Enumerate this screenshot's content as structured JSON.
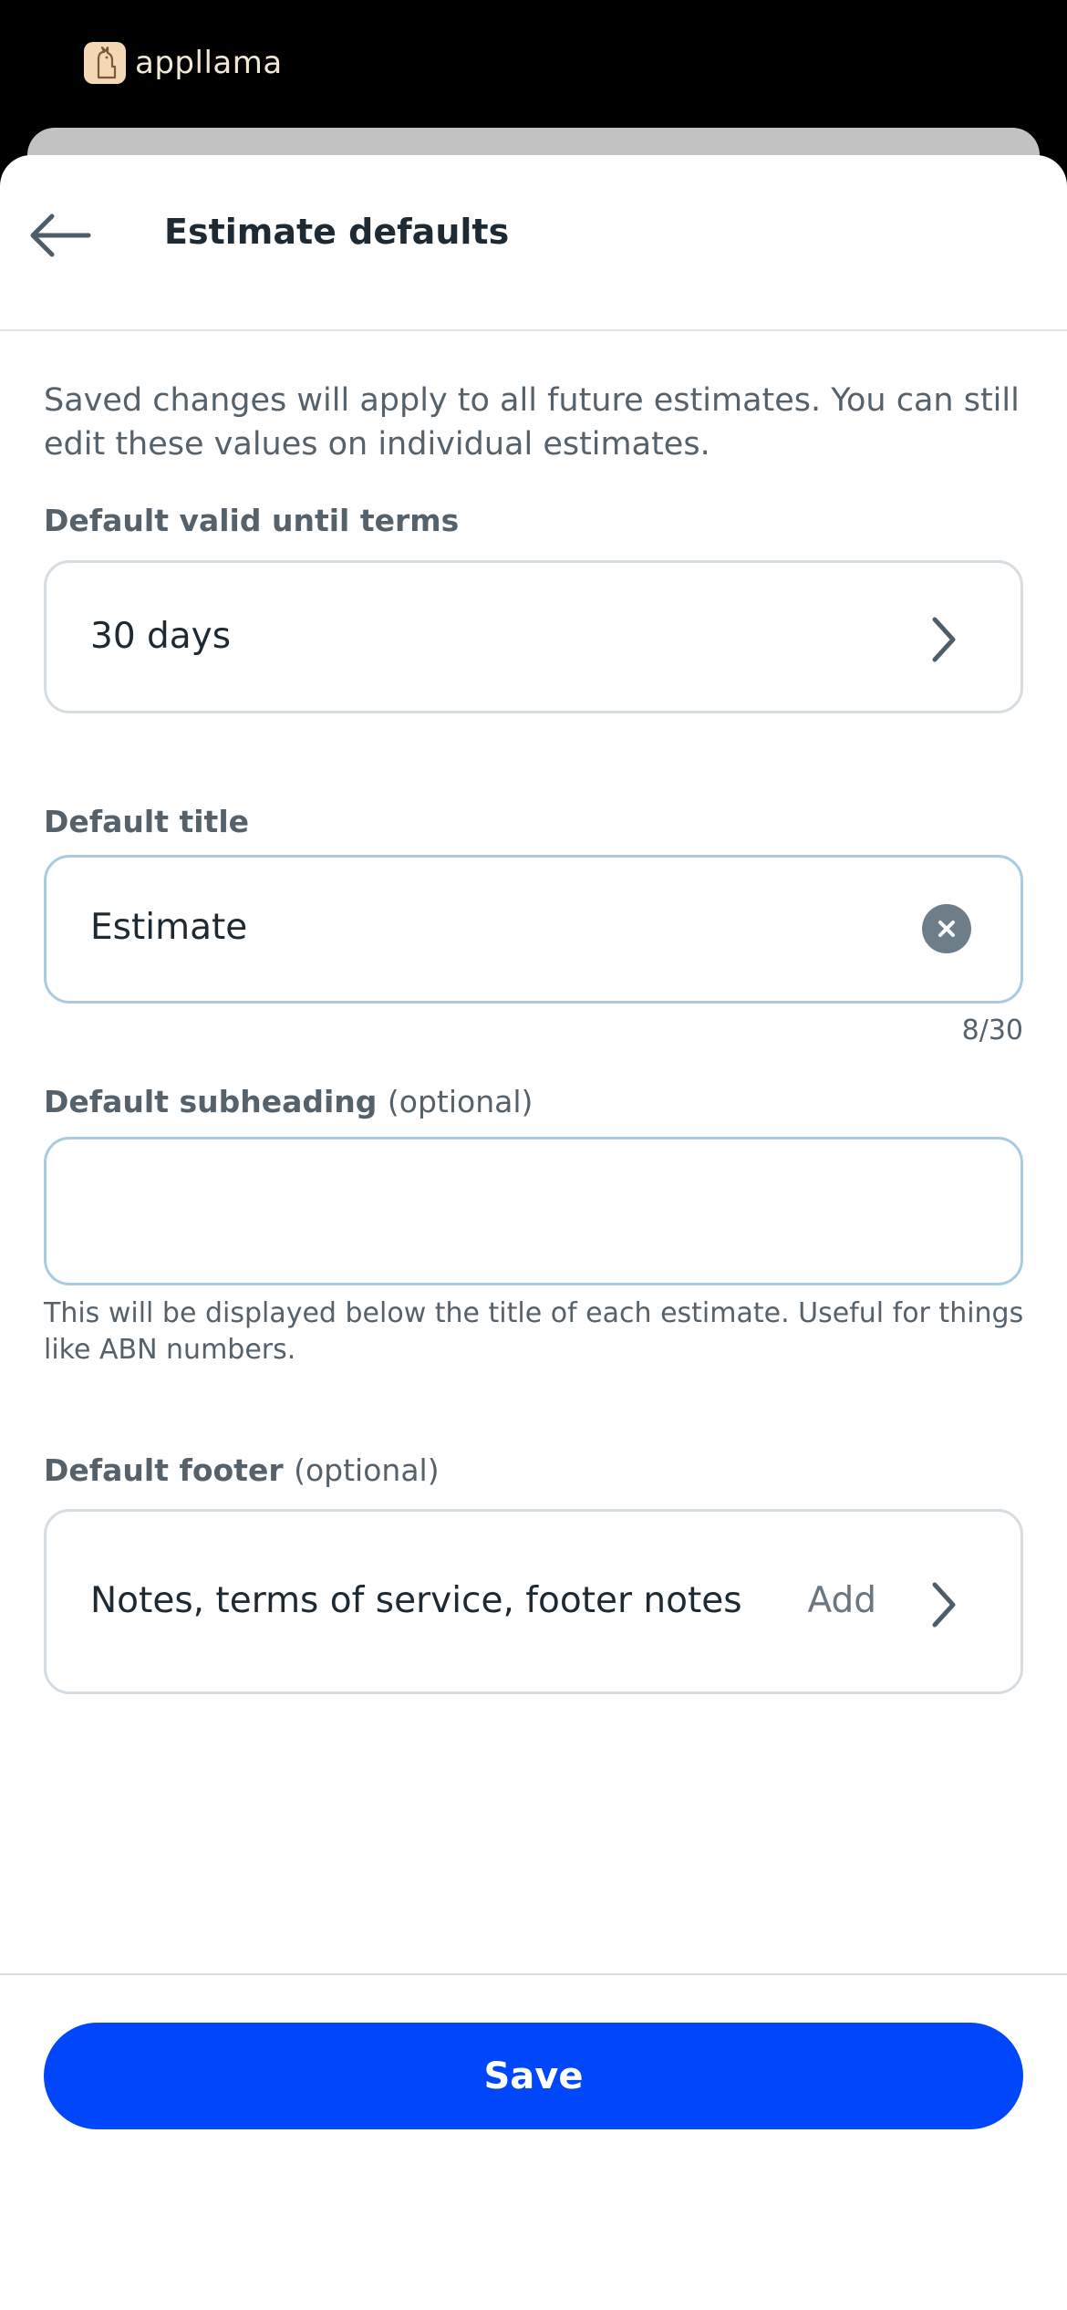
{
  "brand": {
    "name": "appllama",
    "logo_icon": "llama-logo-icon"
  },
  "header": {
    "title": "Estimate defaults",
    "back_icon": "arrow-left-icon"
  },
  "intro_text": "Saved changes will apply to all future estimates. You can still edit these values on individual estimates.",
  "valid_until": {
    "label": "Default valid until terms",
    "value": "30 days",
    "icon": "chevron-right-icon"
  },
  "default_title": {
    "label": "Default title",
    "value": "Estimate",
    "counter": "8/30",
    "clear_icon": "clear-circle-icon"
  },
  "subheading": {
    "label": "Default subheading",
    "optional": "(optional)",
    "value": "",
    "helper": "This will be displayed below the title of each estimate. Useful for things like ABN numbers."
  },
  "footer": {
    "label": "Default footer",
    "optional": "(optional)",
    "row_label": "Notes, terms of service, footer notes",
    "action": "Add",
    "icon": "chevron-right-icon"
  },
  "save_label": "Save",
  "colors": {
    "primary": "#0047fb",
    "field_border_active": "#a9cbe0",
    "field_border": "#d6dde2",
    "text_muted": "#55616b"
  }
}
